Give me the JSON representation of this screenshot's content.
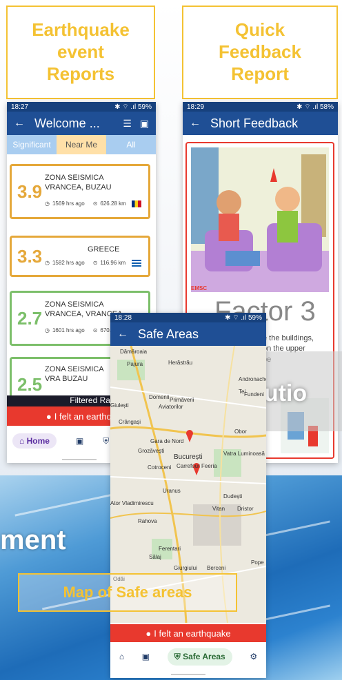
{
  "labels": {
    "earthquake": "Earthquake\nevent\nReports",
    "feedback": "Quick\nFeedback\nReport",
    "safe_areas": "Map of Safe areas",
    "solution_partial": "Solutio",
    "element_partial": "ment"
  },
  "phone1": {
    "time": "18:27",
    "status_right": "✱ ⌔ .ıl 59%",
    "title": "Welcome ...",
    "tabs": [
      "Significant",
      "Near Me",
      "All"
    ],
    "events": [
      {
        "mag": "3.9",
        "place": "ZONA SEISMICA VRANCEA, BUZAU",
        "time_ago": "1569 hrs ago",
        "distance": "626.28 km",
        "color": "#e5a83a"
      },
      {
        "mag": "3.3",
        "place": "GREECE",
        "time_ago": "1582 hrs ago",
        "distance": "116.96 km",
        "color": "#e5a83a"
      },
      {
        "mag": "2.7",
        "place": "ZONA SEISMICA VRANCEA, VRANCEA",
        "time_ago": "1601 hrs ago",
        "distance": "670.09",
        "color": "#7cbf6a"
      },
      {
        "mag": "2.5",
        "place": "ZONA SEISMICA VRA BUZAU",
        "color": "#7cbf6a"
      }
    ],
    "filtered": "Filtered Radius: 10000",
    "felt": "I felt an earthqu",
    "nav_home": "Home"
  },
  "phone2": {
    "time": "18:29",
    "status_right": "✱ ⌔ .ıl 58%",
    "title": "Short Feedback",
    "brand": "EMSC",
    "factor": "Factor 3",
    "desc_lines": [
      "e the buildings,",
      "on the upper",
      "be"
    ]
  },
  "phone3": {
    "time": "18:28",
    "status_right": "✱ ⌔ .ıl 59%",
    "title": "Safe Areas",
    "map_labels": [
      "Dămăroaia",
      "Pajura",
      "Herăstrău",
      "Giulești",
      "Domenii",
      "Primăverii",
      "Aviatorilor",
      "Crângași",
      "Gara de Nord",
      "Grozăvești",
      "Obor",
      "București",
      "Cotroceni",
      "Carrefour Feeria",
      "Uranus",
      "Vatra Luminoasă",
      "Dudești",
      "Vitan",
      "Dristor",
      "Rahova",
      "Ferentari",
      "Sălaj",
      "Giurgiului",
      "Berceni",
      "Pope",
      "Andronache",
      "Odăi",
      "Tei",
      "Fundeni",
      "Ator Vladimirescu"
    ],
    "felt": "I felt an earthquake",
    "nav_safe": "Safe Areas"
  },
  "colors": {
    "accent": "#f4c233",
    "appbar": "#1f4f95",
    "alert": "#e8392e"
  }
}
